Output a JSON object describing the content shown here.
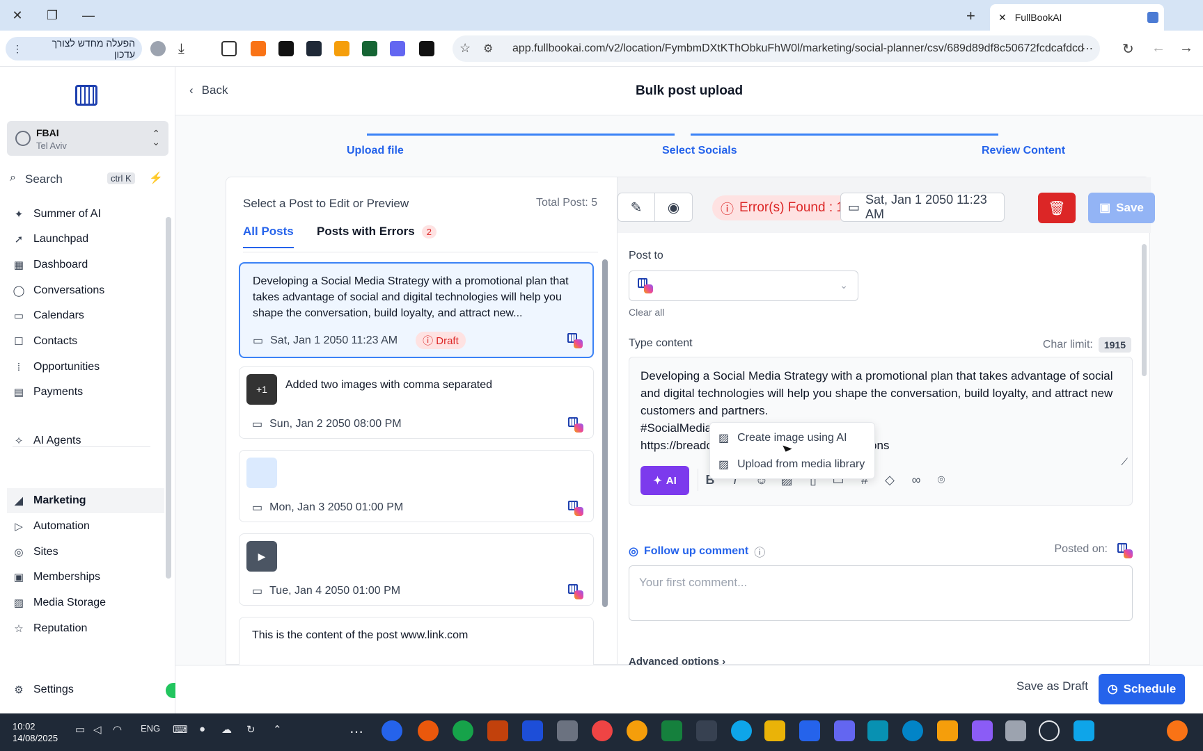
{
  "browser": {
    "tab_title": "FullBookAI",
    "url": "app.fullbookai.com/v2/location/FymbmDXtKThObkuFhW0l/marketing/social-planner/csv/689d89df8c50672fcdcafdcd",
    "promo_button": "הפעלה מחדש לצורך עדכון"
  },
  "sidebar": {
    "location_name": "FBAI",
    "location_sub": "Tel Aviv",
    "search_label": "Search",
    "search_shortcut": "ctrl K",
    "items": [
      {
        "label": "Summer of AI",
        "icon": "sparkle-icon"
      },
      {
        "label": "Launchpad",
        "icon": "rocket-icon"
      },
      {
        "label": "Dashboard",
        "icon": "grid-icon"
      },
      {
        "label": "Conversations",
        "icon": "chat-icon"
      },
      {
        "label": "Calendars",
        "icon": "calendar-icon"
      },
      {
        "label": "Contacts",
        "icon": "user-icon"
      },
      {
        "label": "Opportunities",
        "icon": "pipeline-icon"
      },
      {
        "label": "Payments",
        "icon": "card-icon"
      },
      {
        "label": "AI Agents",
        "icon": "sparkle-icon"
      },
      {
        "label": "Marketing",
        "icon": "megaphone-icon"
      },
      {
        "label": "Automation",
        "icon": "play-icon"
      },
      {
        "label": "Sites",
        "icon": "globe-icon"
      },
      {
        "label": "Memberships",
        "icon": "membership-icon"
      },
      {
        "label": "Media Storage",
        "icon": "image-icon"
      },
      {
        "label": "Reputation",
        "icon": "star-icon"
      }
    ],
    "settings_label": "Settings"
  },
  "header": {
    "back_label": "Back",
    "title": "Bulk post upload"
  },
  "steps": [
    "Upload file",
    "Select Socials",
    "Review Content"
  ],
  "post_list": {
    "heading": "Select a Post to Edit or Preview",
    "total": "Total Post: 5",
    "tab_all": "All Posts",
    "tab_errors": "Posts with Errors",
    "errors_count": "2",
    "posts": [
      {
        "text": "Developing a Social Media Strategy with a promotional plan that takes advantage of social and digital technologies will help you shape the conversation, build loyalty, and attract new...",
        "date": "Sat, Jan 1 2050 11:23 AM",
        "status": "Draft"
      },
      {
        "text": "Added two images with comma separated",
        "date": "Sun, Jan 2 2050 08:00 PM",
        "thumb": "+1"
      },
      {
        "text": "",
        "date": "Mon, Jan 3 2050 01:00 PM"
      },
      {
        "text": "",
        "date": "Tue, Jan 4 2050 01:00 PM"
      },
      {
        "text": "This is the content of the post www.link.com",
        "date": ""
      }
    ]
  },
  "editor": {
    "errors_label": "Error(s) Found : 1",
    "date": "Sat, Jan 1 2050 11:23 AM",
    "save_label": "Save",
    "post_to_label": "Post to",
    "clear_all": "Clear all",
    "type_content_label": "Type content",
    "char_limit_label": "Char limit:",
    "char_limit_value": "1915",
    "content_line1": "Developing a Social Media Strategy with a promotional plan that takes advantage of social and digital technologies will help you shape the conversation, build loyalty, and attract new customers and partners.",
    "content_line2_start": "#SocialMedia",
    "content_line3_start": "https://breadc",
    "content_line3_end": "-questions",
    "ai_label": "AI",
    "menu_create_ai": "Create image using AI",
    "menu_upload_library": "Upload from media library",
    "follow_up_label": "Follow up comment",
    "posted_on_label": "Posted on:",
    "comment_placeholder": "Your first comment...",
    "advanced_label": "Advanced options"
  },
  "footer": {
    "save_draft": "Save as Draft",
    "schedule": "Schedule"
  },
  "taskbar": {
    "time": "10:02",
    "date": "14/08/2025",
    "lang": "ENG"
  }
}
